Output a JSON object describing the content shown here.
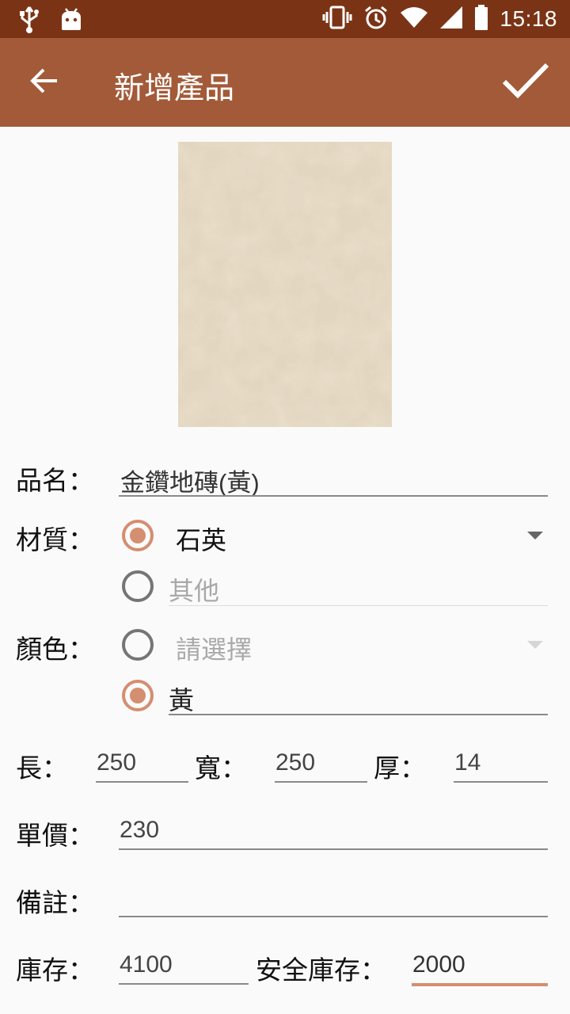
{
  "status_bar": {
    "time": "15:18",
    "left_icons": [
      "usb-icon",
      "android-icon"
    ],
    "right_icons": [
      "vibrate-icon",
      "alarm-icon",
      "wifi-icon",
      "signal-icon",
      "battery-icon"
    ]
  },
  "app_bar": {
    "title": "新增產品",
    "back_icon": "arrow-back-icon",
    "confirm_icon": "check-icon"
  },
  "form": {
    "name_label": "品名：",
    "name_value": "金鑽地磚(黃)",
    "material_label": "材質：",
    "material_spinner_value": "石英",
    "material_other_placeholder": "其他",
    "color_label": "顏色：",
    "color_spinner_placeholder": "請選擇",
    "color_custom_value": "黃",
    "length_label": "長：",
    "length_value": "250",
    "width_label": "寬：",
    "width_value": "250",
    "thickness_label": "厚：",
    "thickness_value": "14",
    "price_label": "單價：",
    "price_value": "230",
    "note_label": "備註：",
    "note_value": "",
    "stock_label": "庫存：",
    "stock_value": "4100",
    "safety_stock_label": "安全庫存：",
    "safety_stock_value": "2000"
  },
  "colors": {
    "status_bar": "#7a3415",
    "app_bar": "#a35a38",
    "accent": "#d48e70"
  }
}
